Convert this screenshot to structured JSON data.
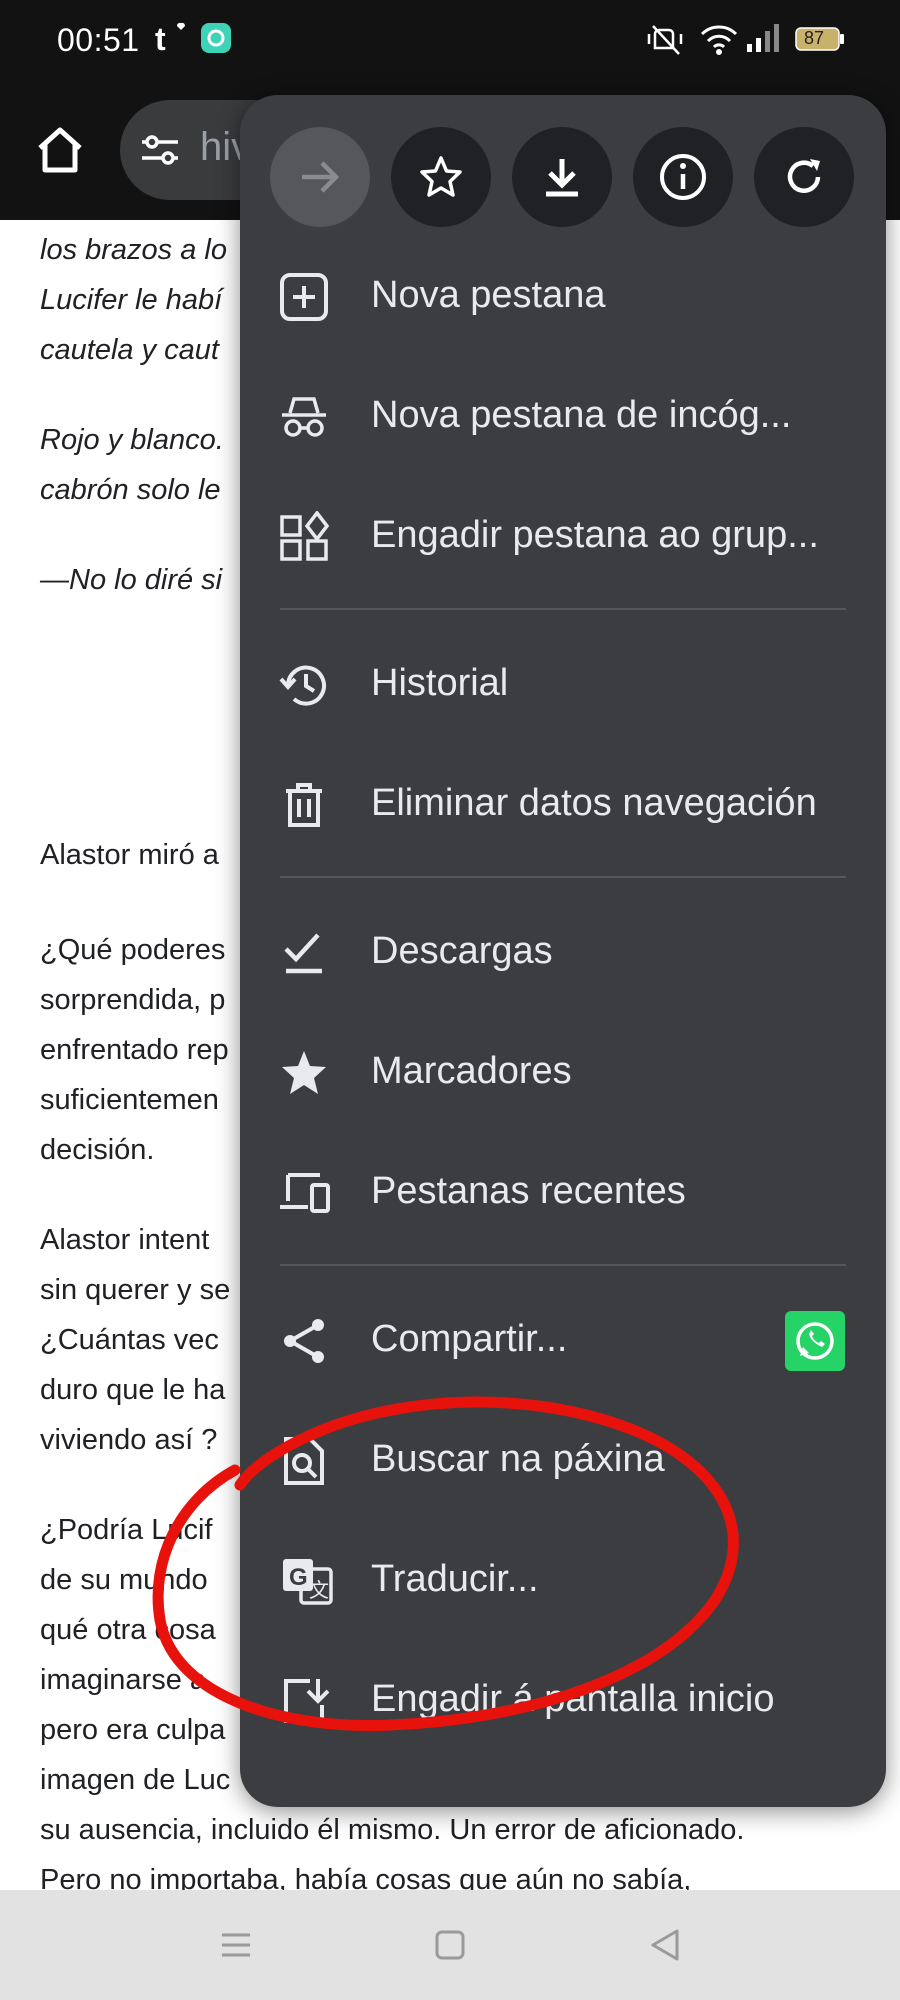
{
  "status_bar": {
    "time": "00:51",
    "battery": "87",
    "icons": [
      "tumblr-icon",
      "app-notification-icon",
      "vibrate-off-icon",
      "wifi-icon",
      "signal-icon",
      "battery-icon"
    ]
  },
  "toolbar": {
    "url_partial": "hiv",
    "icons": [
      "home-icon",
      "site-settings-icon"
    ]
  },
  "page": {
    "lines": [
      {
        "text": "los brazos a lo",
        "italic": true
      },
      {
        "text": "Lucifer le habí",
        "italic": true
      },
      {
        "text": "cautela y caut",
        "italic": true
      },
      {
        "text": "Rojo y blanco.",
        "italic": true
      },
      {
        "text": "cabrón solo le",
        "italic": true
      },
      {
        "text": "—No lo diré si",
        "italic": true
      },
      {
        "text": "Alastor miró a",
        "italic": false
      },
      {
        "text": "¿Qué poderes",
        "italic": false
      },
      {
        "text": "sorprendida, p",
        "italic": false
      },
      {
        "text": "enfrentado rep",
        "italic": false
      },
      {
        "text": "suficientemen",
        "italic": false
      },
      {
        "text": "decisión.",
        "italic": false
      },
      {
        "text": "Alastor intent",
        "italic": false
      },
      {
        "text": "sin querer y se",
        "italic": false
      },
      {
        "text": "¿Cuántas vec",
        "italic": false
      },
      {
        "text": "duro que le ha",
        "italic": false
      },
      {
        "text": "viviendo así ?",
        "italic": false
      },
      {
        "text": "¿Podría Lucif",
        "italic": false
      },
      {
        "text": "de su mundo",
        "italic": false
      },
      {
        "text": "qué otra cosa",
        "italic": false
      },
      {
        "text": "imaginarse a",
        "italic": false
      },
      {
        "text": "pero era culpa",
        "italic": false
      },
      {
        "text": "imagen de Luc",
        "italic": false
      },
      {
        "text": "su ausencia, incluido él mismo. Un error de aficionado.",
        "italic": false
      },
      {
        "text": "Pero no importaba, había cosas que aún no sabía,",
        "italic": false
      }
    ]
  },
  "menu": {
    "top_actions": [
      {
        "name": "forward-button",
        "icon": "arrow-forward-icon",
        "disabled": true
      },
      {
        "name": "bookmark-button",
        "icon": "star-outline-icon",
        "disabled": false
      },
      {
        "name": "download-button",
        "icon": "download-icon",
        "disabled": false
      },
      {
        "name": "page-info-button",
        "icon": "info-icon",
        "disabled": false
      },
      {
        "name": "reload-button",
        "icon": "refresh-icon",
        "disabled": false
      }
    ],
    "items": [
      {
        "label": "Nova pestana",
        "icon": "new-tab-icon"
      },
      {
        "label": "Nova pestana de incóg...",
        "icon": "incognito-icon"
      },
      {
        "label": "Engadir pestana ao grup...",
        "icon": "tab-group-icon"
      },
      {
        "label": "Historial",
        "icon": "history-icon"
      },
      {
        "label": "Eliminar datos navegación",
        "icon": "trash-icon"
      },
      {
        "label": "Descargas",
        "icon": "downloads-icon"
      },
      {
        "label": "Marcadores",
        "icon": "star-icon"
      },
      {
        "label": "Pestanas recentes",
        "icon": "devices-icon"
      },
      {
        "label": "Compartir...",
        "icon": "share-icon"
      },
      {
        "label": "Buscar na páxina",
        "icon": "find-in-page-icon"
      },
      {
        "label": "Traducir...",
        "icon": "translate-icon"
      },
      {
        "label": "Engadir á pantalla inicio",
        "icon": "add-to-home-icon"
      }
    ],
    "share_shortcut": "whatsapp-icon"
  },
  "annotation": {
    "color": "#e8120c",
    "note": "hand-drawn red circle around translate option"
  },
  "nav_bar": {
    "icons": [
      "menu-icon",
      "home-square-icon",
      "back-triangle-icon"
    ]
  }
}
